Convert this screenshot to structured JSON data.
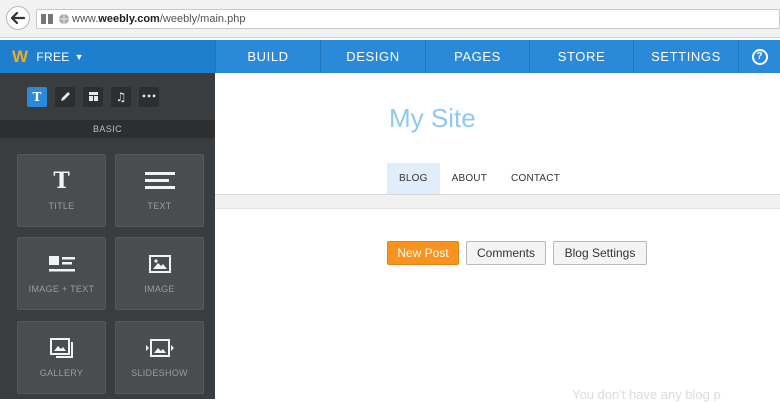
{
  "browser": {
    "url_prefix": "www.",
    "url_domain": "weebly.com",
    "url_path": "/weebly/main.php"
  },
  "topnav": {
    "brand_logo": "W",
    "plan_label": "FREE",
    "tabs": [
      "BUILD",
      "DESIGN",
      "PAGES",
      "STORE",
      "SETTINGS"
    ],
    "help_label": "?"
  },
  "sidebar": {
    "tools": [
      {
        "icon": "text-tool-icon",
        "glyph": "T"
      },
      {
        "icon": "pencil-tool-icon",
        "glyph": "✎"
      },
      {
        "icon": "layout-tool-icon",
        "glyph": "▭"
      },
      {
        "icon": "music-tool-icon",
        "glyph": "♫"
      },
      {
        "icon": "more-tool-icon",
        "glyph": "•••"
      }
    ],
    "section_label": "BASIC",
    "elements": [
      {
        "label": "TITLE",
        "icon": "title-icon"
      },
      {
        "label": "TEXT",
        "icon": "text-lines-icon"
      },
      {
        "label": "IMAGE + TEXT",
        "icon": "image-text-icon"
      },
      {
        "label": "IMAGE",
        "icon": "image-icon"
      },
      {
        "label": "GALLERY",
        "icon": "gallery-icon"
      },
      {
        "label": "SLIDESHOW",
        "icon": "slideshow-icon"
      }
    ]
  },
  "main": {
    "site_title": "My Site",
    "subnav": [
      "BLOG",
      "ABOUT",
      "CONTACT"
    ],
    "buttons": {
      "new_post": "New Post",
      "comments": "Comments",
      "blog_settings": "Blog Settings"
    },
    "empty_message": "You don't have any blog p"
  },
  "colors": {
    "nav_blue": "#2a89d9",
    "accent_orange": "#f7931e",
    "sidebar_dark": "#3a3d3f",
    "title_blue": "#8fc9ef"
  }
}
